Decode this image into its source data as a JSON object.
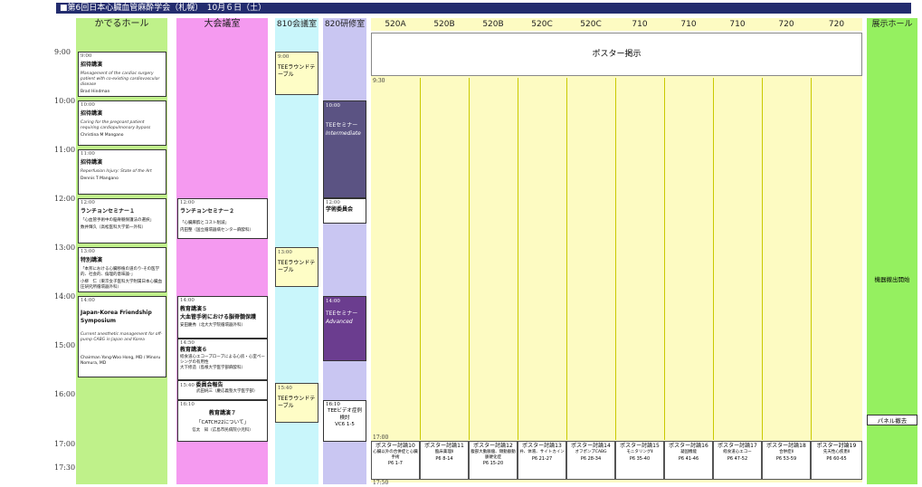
{
  "title": "■第6回日本心臓血管麻酔学会（札幌）　10月６日（土）",
  "halls": [
    "かでるホール",
    "大会議室",
    "810会議室",
    "820研修室",
    "520A",
    "520B",
    "520B",
    "520C",
    "520C",
    "710",
    "710",
    "710",
    "720",
    "720",
    "展示ホール"
  ],
  "times": [
    "9:00",
    "10:00",
    "11:00",
    "12:00",
    "13:00",
    "14:00",
    "15:00",
    "16:00",
    "17:00",
    "17:30"
  ],
  "kaderu": [
    {
      "time": "9:00",
      "head": "招待講演",
      "sub": "Management of the cardiac surgery patient with co-existing cardiovascular disease",
      "person": "Brad Hindman"
    },
    {
      "time": "10:00",
      "head": "招待講演",
      "sub": "Caring for the pregnant patient requiring cardiopulmonary bypass",
      "person": "Christina M Mangano"
    },
    {
      "time": "11:00",
      "head": "招待講演",
      "sub": "Reperfusion Injury: State of the Art",
      "person": "Dennis T Mangano"
    },
    {
      "time": "12:00",
      "head": "ランチョンセミナー１",
      "sub": "「心血管手術中の脳脊髄保護法の選択」",
      "person": "数井輝久（高松医科大学第一外科）"
    },
    {
      "time": "13:00",
      "head": "特別講演",
      "sub": "「本邦における心臓移植の道のり-その医学的、社会的、倫理的意味論-」",
      "person": "小柳　仁（東京女子医科大学附属日本心臓血圧研究所循環器外科）"
    },
    {
      "time": "14:00",
      "head": "Japan-Korea Friendship Symposium",
      "sub": "Current anesthetic management for off-pump CABG in Japan and Korea",
      "person": "Chairman Yong-Woo Hong, MD / Minoru Nomura, MD"
    }
  ],
  "daikaigi": [
    {
      "time": "12:00",
      "head": "ランチョンセミナー２",
      "sub": "「心臓麻酔とコスト削減」",
      "person": "内田整（国立循環器病センター麻酔科）"
    },
    {
      "time": "14:00",
      "head": "教育講演５",
      "sub": "大血管手術における脳脊髄保護",
      "person": "安田慶秀（北大大学院循環器外科）"
    },
    {
      "time": "14:50",
      "head": "教育講演６",
      "sub": "経食道心エコープローブによる心房・心室ペーシングの有用性",
      "person": "大下修造（島根大学医学部麻酔科）"
    },
    {
      "time": "15:40",
      "head": "委員会報告",
      "sub": "",
      "person": "武田純三（慶応義塾大学医学部）"
    },
    {
      "time": "16:10",
      "head": "教育講演７",
      "sub": "「CATCH22について」",
      "person": "信太　知（広島市民病院小児科）"
    }
  ],
  "room810": [
    {
      "time": "9:00",
      "label": "TEEラウンドテーブル"
    },
    {
      "time": "13:00",
      "label": "TEEラウンドテーブル"
    },
    {
      "time": "15:40",
      "label": "TEEラウンドテーブル"
    }
  ],
  "room820": [
    {
      "time": "10:00",
      "label": "TEEセミナー",
      "sub": "Intermediate"
    },
    {
      "time": "12:00",
      "label": "学術委員会"
    },
    {
      "time": "14:00",
      "label": "TEEセミナー",
      "sub": "Advanced"
    },
    {
      "time": "16:10",
      "label": "TEEビデオ症例検討",
      "sub": "VC6 1-5"
    }
  ],
  "poster": {
    "banner": "ポスター掲示",
    "start": "9:30",
    "end_start": "17:00",
    "end": "17:50"
  },
  "poster_sessions": [
    {
      "a": "ポスター討論10",
      "b": "心臓以外の合併症と心臓手術",
      "c": "P6 1-7"
    },
    {
      "a": "ポスター討論11",
      "b": "臨床薬理Ⅱ",
      "c": "P6 8-14"
    },
    {
      "a": "ポスター討論12",
      "b": "腹部大動脈瘤、頸動脈動脈硬化症",
      "c": "P6 15-20"
    },
    {
      "a": "ポスター討論13",
      "b": "弁、体液、サイトカイン",
      "c": "P6 21-27"
    },
    {
      "a": "ポスター討論14",
      "b": "オフポンプCABG",
      "c": "P6 28-34"
    },
    {
      "a": "ポスター討論15",
      "b": "モニタリングⅡ",
      "c": "P6 35-40"
    },
    {
      "a": "ポスター討論16",
      "b": "凝固機能",
      "c": "P6 41-46"
    },
    {
      "a": "ポスター討論17",
      "b": "経食道心エコー",
      "c": "P6 47-52"
    },
    {
      "a": "ポスター討論18",
      "b": "合併症Ⅱ",
      "c": "P6 53-59"
    },
    {
      "a": "ポスター討論19",
      "b": "先天性心疾患Ⅱ",
      "c": "P6 60-65"
    }
  ],
  "exhibit": {
    "mid": "機器撤出開始",
    "end": "パネル撤去"
  },
  "colors": {
    "kaderu": "#bff18a",
    "daikaigi": "#f59af0",
    "room810": "#c9f6fb",
    "room820": "#c9c6f2",
    "poster": "#fdfbc2",
    "exhibit": "#95f060",
    "teepurple": "#6b3d8f",
    "teedark": "#5b5383"
  }
}
